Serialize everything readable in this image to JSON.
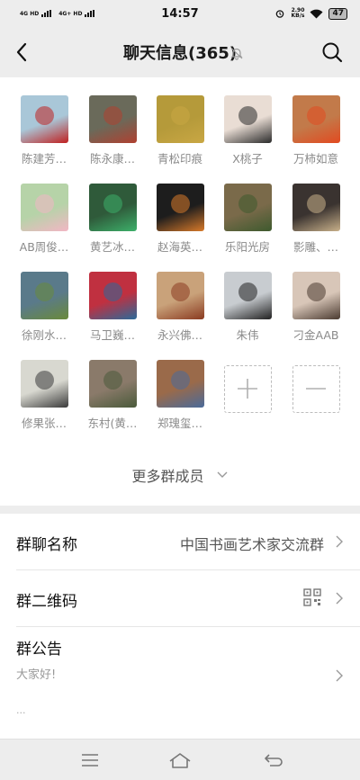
{
  "status_bar": {
    "time": "14:57",
    "signal1": "4G HD",
    "signal2": "4G+ HD",
    "net_speed": "2.90",
    "net_unit": "KB/s",
    "battery": "47"
  },
  "header": {
    "title": "聊天信息(365)"
  },
  "members": [
    {
      "name": "陈建芳…",
      "color": "#a9c7d8",
      "accent": "#c02020"
    },
    {
      "name": "陈永康…",
      "color": "#6a6a5a",
      "accent": "#b04030"
    },
    {
      "name": "青松印痕",
      "color": "#b59a3a",
      "accent": "#c9a744"
    },
    {
      "name": "X桃子",
      "color": "#e9ddd4",
      "accent": "#2a2a2a"
    },
    {
      "name": "万柿如意",
      "color": "#c27a4a",
      "accent": "#e24a20"
    },
    {
      "name": "AB周俊…",
      "color": "#b6d3a8",
      "accent": "#f2b6c4"
    },
    {
      "name": "黄艺冰…",
      "color": "#2f5a3a",
      "accent": "#3db06a"
    },
    {
      "name": "赵海英…",
      "color": "#1d1d1d",
      "accent": "#d87a2a"
    },
    {
      "name": "乐阳光房",
      "color": "#7a6a4a",
      "accent": "#3e5a2e"
    },
    {
      "name": "影雕、…",
      "color": "#3a3330",
      "accent": "#c8b08a"
    },
    {
      "name": "徐刚水…",
      "color": "#5a7a8a",
      "accent": "#6a8a3a"
    },
    {
      "name": "马卫巍…",
      "color": "#c03040",
      "accent": "#2a6a9a"
    },
    {
      "name": "永兴佛…",
      "color": "#c9a27a",
      "accent": "#8a3a20"
    },
    {
      "name": "朱伟",
      "color": "#c8ccd0",
      "accent": "#202020"
    },
    {
      "name": "刁金AAB",
      "color": "#d8c6b8",
      "accent": "#4a3a30"
    },
    {
      "name": "修果张…",
      "color": "#d8d8d0",
      "accent": "#3a3a3a"
    },
    {
      "name": "东村(黄…",
      "color": "#8a7a6a",
      "accent": "#4a5a3a"
    },
    {
      "name": "郑瑰玺…",
      "color": "#9a6a4a",
      "accent": "#4a6a9a"
    }
  ],
  "more_members": "更多群成员",
  "settings": {
    "group_name_label": "群聊名称",
    "group_name_value": "中国书画艺术家交流群",
    "qr_label": "群二维码",
    "notice_label": "群公告",
    "notice_text": "大家好!",
    "notice_ellipsis": "..."
  },
  "icons": {
    "back": "chevron-left-icon",
    "bell": "muted-bell-icon",
    "search": "search-icon",
    "add": "plus-icon",
    "remove": "minus-icon",
    "qr": "qr-code-icon",
    "menu": "menu-icon",
    "home": "home-icon",
    "back_nav": "return-icon"
  }
}
